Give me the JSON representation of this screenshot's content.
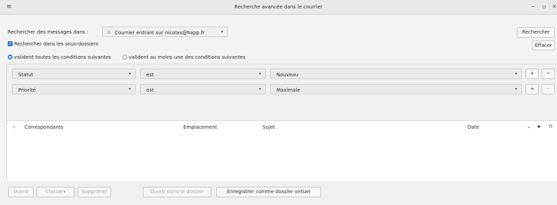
{
  "window": {
    "title": "Recherche avancée dans le courrier"
  },
  "search": {
    "label": "Rechercher des messages dans :",
    "account": "Courrier entrant sur nicolas@happ.fr",
    "subfolders_label": "Rechercher dans les sous-dossiers",
    "match_all_label": "valident toutes les conditions suivantes",
    "match_any_label": "valident au moins une des conditions suivantes",
    "search_button": "Rechercher",
    "clear_button": "Effacer"
  },
  "conditions": [
    {
      "field": "Statut",
      "operator": "est",
      "value": "Nouveau",
      "add": "+",
      "remove": "−"
    },
    {
      "field": "Priorité",
      "operator": "est",
      "value": "Maximale",
      "add": "+",
      "remove": "−"
    }
  ],
  "results": {
    "columns": {
      "correspondents": "Correspondants",
      "location": "Emplacement",
      "subject": "Sujet",
      "date": "Date"
    }
  },
  "footer": {
    "open": "Ouvrir",
    "file": "Classer▾",
    "delete": "Supprimer",
    "open_in_folder": "Ouvrir dans le dossier",
    "save_virtual": "Enregistrer comme dossier virtuel"
  }
}
